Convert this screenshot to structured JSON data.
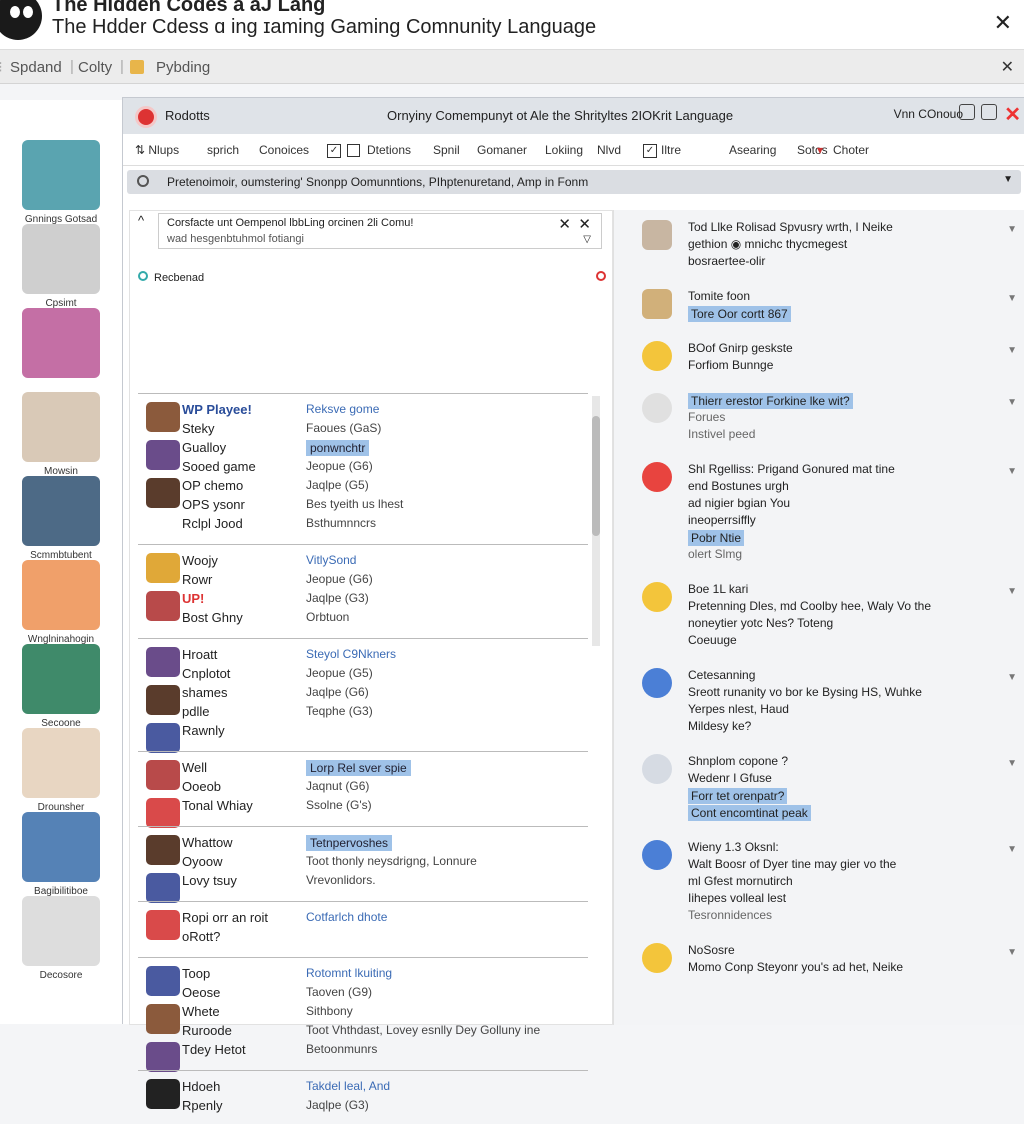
{
  "window": {
    "title_line1": "The Hidden Codes a aJ Lang",
    "title_line2": "The Hdder Cdess ɑ ing  ɪaming Gaming Comnunity Language",
    "close_glyph": "✕"
  },
  "tabs": [
    "Spdand",
    "Colty",
    "Pybding"
  ],
  "tab_close": "✕",
  "rail": [
    {
      "label": "Gnnings Gotsad",
      "color": "#5aa4b0"
    },
    {
      "label": "Cpsimt",
      "color": "#cfcfcf"
    },
    {
      "label": "",
      "color": "#c46fa5"
    },
    {
      "label": "Mowsin",
      "color": "#d9c9b7"
    },
    {
      "label": "Scmmbtubent",
      "color": "#4d6a86"
    },
    {
      "label": "Wnglninahogin",
      "color": "#f0a06a"
    },
    {
      "label": "Secoone",
      "color": "#3f8a6a"
    },
    {
      "label": "Drounsher",
      "color": "#e8d6c2"
    },
    {
      "label": "Bagibilitiboe",
      "color": "#5582b6"
    },
    {
      "label": "Decosore",
      "color": "#dddddd"
    }
  ],
  "topbar": {
    "label": "Rodotts",
    "center": "Ornyiny Comempunyt ot Ale the Shrityltes 2IOKrit Language",
    "right": "Vnn COnouo"
  },
  "toolbar": [
    "Nlups",
    "sprich",
    "Conoices",
    "Dtetions",
    "Spnil",
    "Gomaner",
    "Lokiing",
    "Nlvd",
    "Iltre",
    "Asearing",
    "Sotos",
    "Choter"
  ],
  "filter": "Pretenoimoir, oumstering' Snonpp Oomunntions, PIhptenuretand, Amp in Fonm",
  "search": {
    "line1": "Corsfacte unt Oempenol lbbLing orcinen 2li Comu!",
    "line2": "wad hesgenbtuhmol fotiangi"
  },
  "rec_label": "Recbenad",
  "groups": [
    {
      "rows": [
        {
          "name": "WP Playee!",
          "value": "Reksve gome",
          "style": "blue"
        },
        {
          "name": "Steky",
          "value": "Faoues (GaS)",
          "style": ""
        },
        {
          "name": "Gualloy",
          "value": "ponwnchtr",
          "style": "hl"
        },
        {
          "name": "Sooed game",
          "value": "Jeopue (G6)",
          "style": ""
        },
        {
          "name": "OP chemo",
          "value": "Jaqlpe (G5)",
          "style": ""
        },
        {
          "name": "OPS ysonr",
          "value": "Bes tyeith us lhest",
          "style": ""
        },
        {
          "name": "Rclpl  Jood",
          "value": "Bsthumnncrs",
          "style": ""
        }
      ]
    },
    {
      "rows": [
        {
          "name": "Woojy",
          "value": "VitlySond",
          "style": "blue"
        },
        {
          "name": "Rowr",
          "value": "Jeopue (G6)",
          "style": ""
        },
        {
          "name": "UP!",
          "value": "Jaqlpe (G3)",
          "style": ""
        },
        {
          "name": "Bost Ghny",
          "value": "Orbtuon",
          "style": ""
        }
      ]
    },
    {
      "rows": [
        {
          "name": "Hroatt",
          "value": "Steyol C9Nkners",
          "style": "blue"
        },
        {
          "name": "Cnplotot",
          "value": "Jeopue (G5)",
          "style": ""
        },
        {
          "name": "shames",
          "value": "Jaqlpe (G6)",
          "style": ""
        },
        {
          "name": "pdlle",
          "value": "Teqphe (G3)",
          "style": ""
        },
        {
          "name": "Rawnly",
          "value": "",
          "style": ""
        }
      ]
    },
    {
      "rows": [
        {
          "name": "Well",
          "value": "Lorp Rel sver spie",
          "style": "hl"
        },
        {
          "name": "Ooeob",
          "value": "Jaqnut (G6)",
          "style": ""
        },
        {
          "name": "Tonal  Whiay",
          "value": "Ssolne (G's)",
          "style": ""
        }
      ]
    },
    {
      "rows": [
        {
          "name": "Whattow",
          "value": "Tetnpervoshes",
          "style": "hl"
        },
        {
          "name": "Oyoow",
          "value": "Toot thonly neysdrigng, Lonnure",
          "style": ""
        },
        {
          "name": "Lovy tsuy",
          "value": "Vrevonlidors.",
          "style": ""
        }
      ]
    },
    {
      "rows": [
        {
          "name": "Ropi orr an roit",
          "value": "Cotfarlch dhote",
          "style": "blue"
        },
        {
          "name": "oRott?",
          "value": "",
          "style": ""
        }
      ]
    },
    {
      "rows": [
        {
          "name": "Toop",
          "value": "Rotomnt lkuiting",
          "style": "blue"
        },
        {
          "name": "Oeose",
          "value": "Taoven (G9)",
          "style": ""
        },
        {
          "name": "Whete",
          "value": "Sithbony",
          "style": ""
        },
        {
          "name": "Ruroode",
          "value": "Toot Vhthdast, Lovey esnlly Dey Golluny ine",
          "style": ""
        },
        {
          "name": "Tdey  Hetot",
          "value": "Betoonmunrs",
          "style": ""
        }
      ]
    },
    {
      "rows": [
        {
          "name": "Hdoeh",
          "value": "Takdel leal, And",
          "style": "blue"
        },
        {
          "name": "Rpenly",
          "value": "Jaqlpe (G3)",
          "style": ""
        }
      ]
    }
  ],
  "messages": [
    {
      "lines": [
        "Tod Llke  Rolisad Spvusry wrth, I Neike",
        "gethion ◉ mnichc thycmegest",
        "bosraertee-olir"
      ],
      "color": "#c8b6a2"
    },
    {
      "lines": [
        "Tomite foon",
        "Tore Oor cortt 867"
      ],
      "color": "#d1b07a"
    },
    {
      "lines": [
        "BOof Gnirp geskste",
        "Forfiom Bunnge"
      ],
      "color": "#f3c53b"
    },
    {
      "lines": [
        "Thierr erestor Forkine lke wit?",
        "Forues",
        "Instivel peed"
      ],
      "color": "#e0e0e0"
    },
    {
      "lines": [
        "Shl Rgelliss: Prigand Gonured mat tine",
        "end Bostunes urgh",
        "ad nigier bgian You",
        "ineoperrsiffly",
        "Pobr Ntie",
        "olert Slmg"
      ],
      "color": "#e8443f"
    },
    {
      "lines": [
        "Boe 1L kari",
        "Pretenning  Dles, md Coolby hee, Waly Vo the",
        "noneytier yotc Nes? Toteng",
        "Coeuuge"
      ],
      "color": "#f3c53b"
    },
    {
      "lines": [
        "Cetesanning",
        "Sreott runanity vo bor ke Bysing HS, Wuhke",
        "Yerpes nlest, Haud",
        "Mildesy ke?"
      ],
      "color": "#4b7fd6"
    },
    {
      "lines": [
        "Shnplom copone ?",
        "Wedenr I Gfuse",
        "Forr tet orenpatr?",
        "Cont encomtinat peak"
      ],
      "color": "#d6dbe3"
    },
    {
      "lines": [
        "Wieny 1.3 Oksnl:",
        "Walt Boosr of Dyer tine may gier vo the",
        "ml Gfest mornutirch",
        "Iihepes volleal lest",
        "Tesronnidences"
      ],
      "color": "#4b7fd6"
    },
    {
      "lines": [
        "NoSosre",
        "Momo Conp Steyonr you's ad het, Neike"
      ],
      "color": "#f3c53b"
    }
  ]
}
